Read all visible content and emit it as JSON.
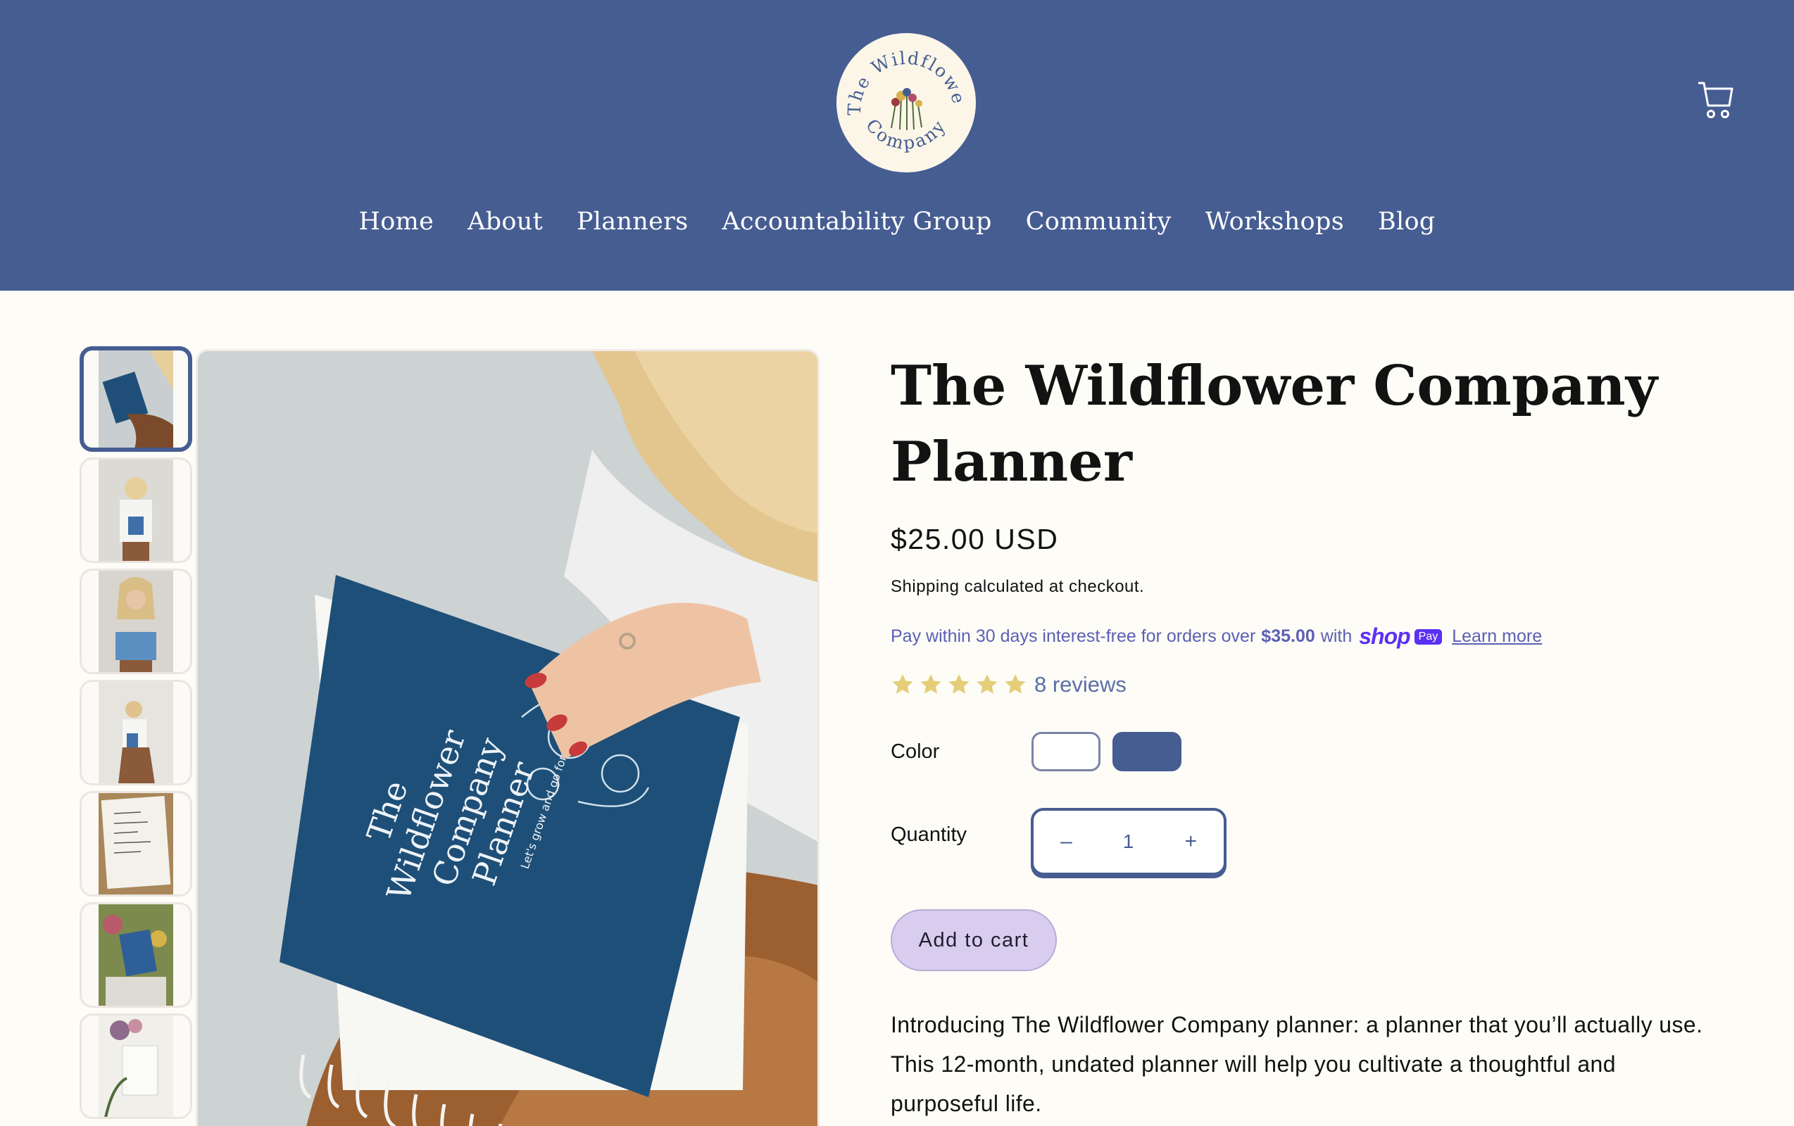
{
  "header": {
    "logo": {
      "line_top": "The Wildflower",
      "line_bottom": "Company"
    },
    "cart_icon": "cart-icon",
    "nav": [
      "Home",
      "About",
      "Planners",
      "Accountability Group",
      "Community",
      "Workshops",
      "Blog"
    ]
  },
  "gallery": {
    "thumbnails": [
      "thumb-1",
      "thumb-2",
      "thumb-3",
      "thumb-4",
      "thumb-5",
      "thumb-6",
      "thumb-7"
    ],
    "active_index": 0,
    "planner_cover": {
      "title_lines": [
        "The",
        "Wildflower",
        "Company",
        "Planner"
      ],
      "tagline": "Let's grow and go forward together"
    }
  },
  "product": {
    "title": "The Wildflower Company Planner",
    "price": "$25.00 USD",
    "shipping_note": "Shipping calculated at checkout.",
    "shop_pay": {
      "text_before": "Pay within 30 days interest-free for orders over",
      "threshold": "$35.00",
      "text_with": "with",
      "brand": "shop",
      "badge": "Pay",
      "learn_more": "Learn more"
    },
    "rating": {
      "stars": 5,
      "max_stars": 5,
      "reviews_label": "8 reviews"
    },
    "color": {
      "label": "Color",
      "options": [
        "#ffffff",
        "#465d92"
      ],
      "selected": 1
    },
    "quantity": {
      "label": "Quantity",
      "value": "1",
      "minus": "–",
      "plus": "+"
    },
    "add_to_cart": "Add to cart",
    "description": "Introducing The Wildflower Company planner: a planner that you’ll actually use. This 12-month, undated planner will help you cultivate a thoughtful and purposeful life."
  },
  "colors": {
    "brand": "#465d92",
    "background": "#fdfcf7",
    "button": "#d8cdee",
    "star": "#e5cd7a"
  }
}
